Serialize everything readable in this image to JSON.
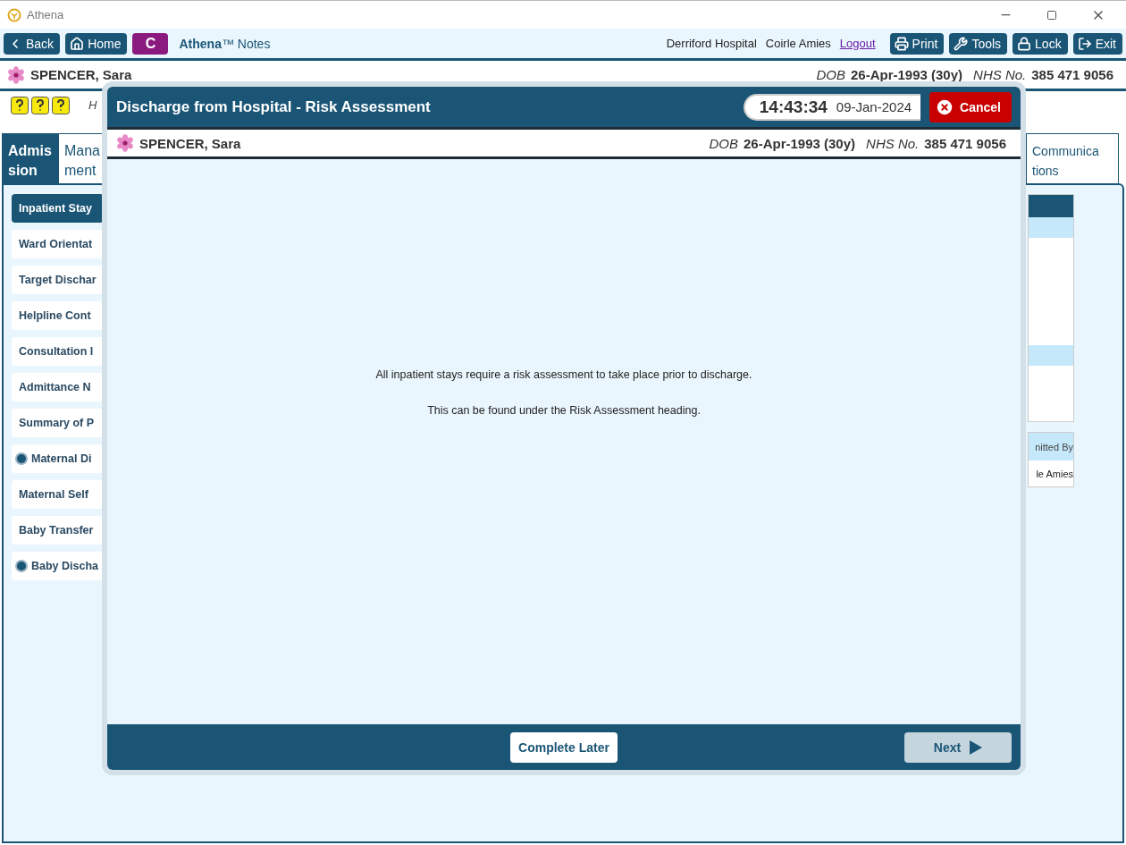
{
  "window": {
    "title": "Athena"
  },
  "toolbar": {
    "nav_buttons": [
      {
        "label": "Back"
      },
      {
        "label": "Home"
      }
    ],
    "badge": "C",
    "app_name": "**Athena**™ Notes",
    "hospital": "Derriford Hospital",
    "user": "Coirle Amies",
    "logout": "Logout",
    "action_buttons": [
      {
        "label": "Print"
      },
      {
        "label": "Tools"
      },
      {
        "label": "Lock"
      },
      {
        "label": "Exit"
      }
    ]
  },
  "patient": {
    "name": "SPENCER, Sara",
    "dob_label": "DOB",
    "dob": "26-Apr-1993 (30y)",
    "nhs_label": "NHS No.",
    "nhs": "385 471 9056"
  },
  "alert_row": {
    "text": "H"
  },
  "tabs": [
    {
      "lines": [
        "Admis",
        "sion"
      ],
      "selected": true
    },
    {
      "lines": [
        "Mana",
        "ment"
      ],
      "selected": false
    },
    {
      "lines": [
        "Communica",
        "tions"
      ],
      "selected": false
    }
  ],
  "sidebar": {
    "items": [
      {
        "label": "Inpatient Stay",
        "selected": true,
        "flagged": false
      },
      {
        "label": "Ward Orientat",
        "selected": false,
        "flagged": false
      },
      {
        "label": "Target Dischar",
        "selected": false,
        "flagged": false
      },
      {
        "label": "Helpline Cont",
        "selected": false,
        "flagged": false
      },
      {
        "label": "Consultation I",
        "selected": false,
        "flagged": false
      },
      {
        "label": "Admittance N",
        "selected": false,
        "flagged": false
      },
      {
        "label": "Summary of P",
        "selected": false,
        "flagged": false
      },
      {
        "label": "Maternal Di",
        "selected": false,
        "flagged": true
      },
      {
        "label": "Maternal Self",
        "selected": false,
        "flagged": false
      },
      {
        "label": "Baby Transfer",
        "selected": false,
        "flagged": false
      },
      {
        "label": "Baby Discha",
        "selected": false,
        "flagged": true
      }
    ]
  },
  "side_table": {
    "column_1": "nitted By",
    "cell": "le Amies"
  },
  "dialog": {
    "title": "Discharge from Hospital - Risk Assessment",
    "time": "14:43:34",
    "date": "09-Jan-2024",
    "cancel": "Cancel",
    "patient": {
      "name": "SPENCER, Sara",
      "dob_label": "DOB",
      "dob": "26-Apr-1993 (30y)",
      "nhs_label": "NHS No.",
      "nhs": "385 471 9056"
    },
    "message": [
      "All inpatient stays require a risk assessment to take place prior to discharge.",
      "This can be found under the Risk Assessment heading."
    ],
    "complete_later": "Complete Later",
    "next": {
      "label": "Next",
      "disabled": true
    }
  }
}
